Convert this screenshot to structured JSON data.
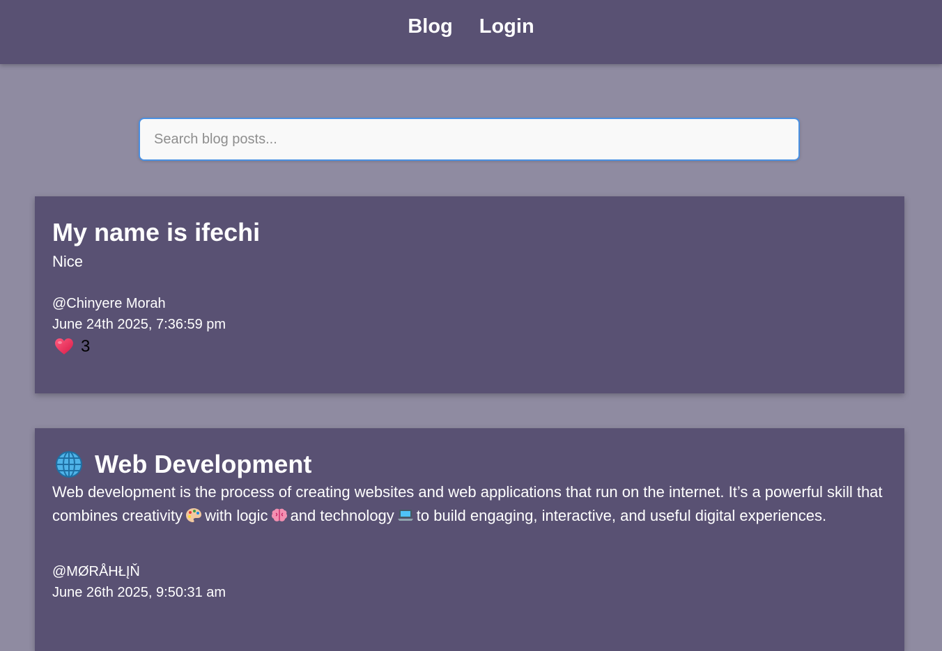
{
  "nav": {
    "links": [
      {
        "label": "Blog"
      },
      {
        "label": "Login"
      }
    ]
  },
  "search": {
    "placeholder": "Search blog posts...",
    "value": ""
  },
  "posts": [
    {
      "title": "My name is ifechi",
      "body": "Nice",
      "author": "@Chinyere Morah",
      "date": "June 24th 2025, 7:36:59 pm",
      "likes": "3",
      "like_icon": "heart-icon"
    },
    {
      "title_icon": "globe-icon",
      "title": "Web Development",
      "body_parts": [
        "Web development is the process of creating websites and web applications that run on the internet. It’s a powerful skill that combines creativity",
        "with logic",
        "and technology",
        "to build engaging, interactive, and useful digital experiences."
      ],
      "body_icons": [
        "palette-icon",
        "brain-icon",
        "laptop-icon"
      ],
      "author": "@MØRÅHŁĮŇ",
      "date": "June 26th 2025, 9:50:31 am"
    }
  ],
  "colors": {
    "background": "#8f8ba1",
    "navbar": "#595173",
    "card": "#595173",
    "search_border": "#4a90e2",
    "heart": "#e8335a"
  }
}
